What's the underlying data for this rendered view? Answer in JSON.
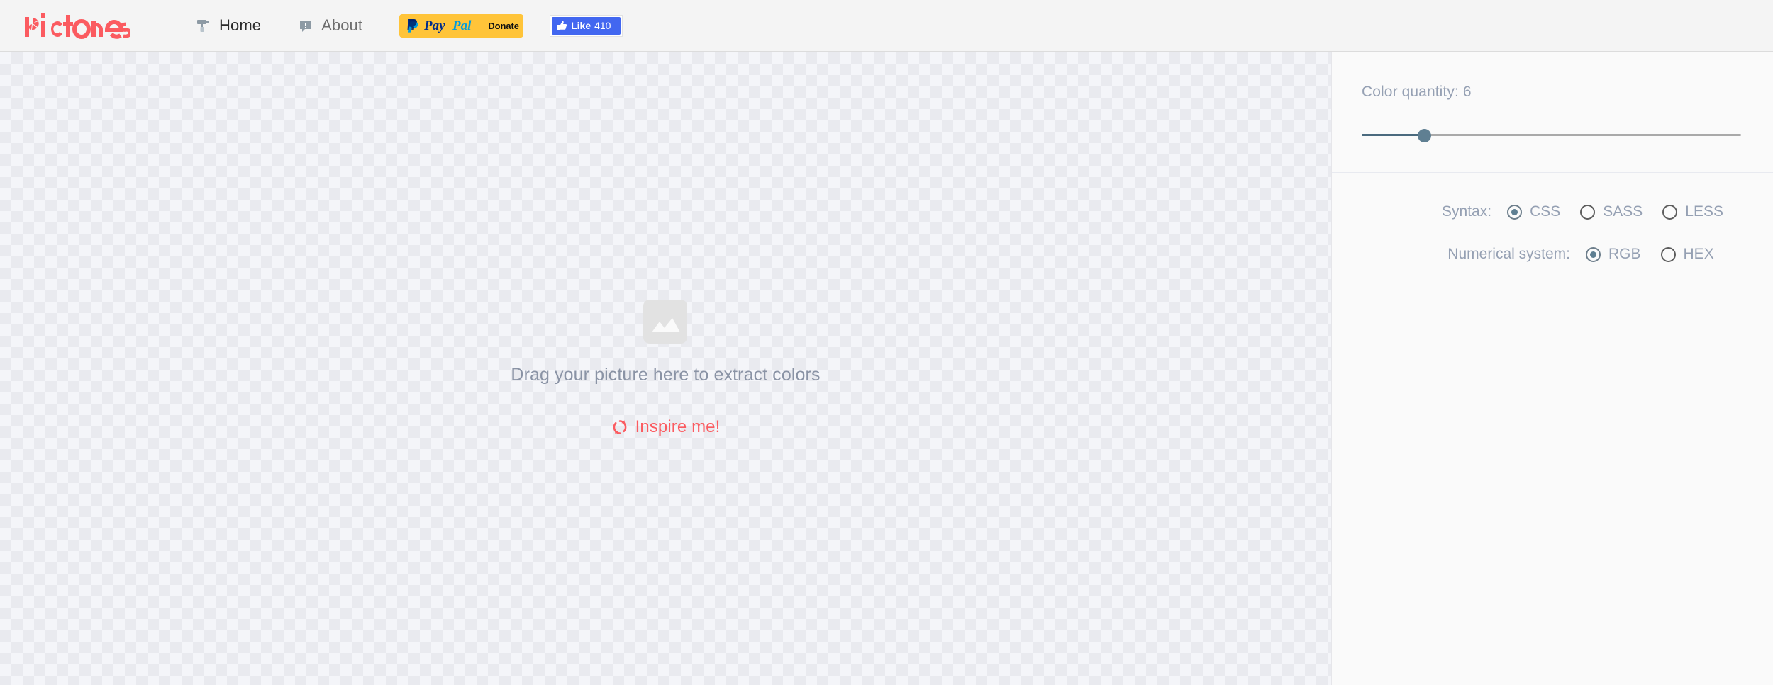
{
  "header": {
    "logo_text": "pictones",
    "logo_color": "#fb5b60",
    "nav": [
      {
        "label": "Home",
        "icon": "paint-roller-icon",
        "active": true
      },
      {
        "label": "About",
        "icon": "comment-alert-icon",
        "active": false
      }
    ],
    "paypal": {
      "brand": "PayPal",
      "action_label": "Donate",
      "bg_color": "#ffc439"
    },
    "facebook": {
      "like_label": "Like",
      "count": "410",
      "bg_color": "#4267f0"
    }
  },
  "dropzone": {
    "placeholder_icon": "image-placeholder-icon",
    "prompt": "Drag your picture here to extract colors",
    "inspire_label": "Inspire me!",
    "inspire_icon": "sync-refresh-icon",
    "inspire_color": "#fb5b60"
  },
  "sidebar": {
    "quantity": {
      "label": "Color quantity: 6",
      "value": 6,
      "slider_percent": 16
    },
    "syntax": {
      "label": "Syntax:",
      "options": [
        {
          "label": "CSS",
          "selected": true
        },
        {
          "label": "SASS",
          "selected": false
        },
        {
          "label": "LESS",
          "selected": false
        }
      ]
    },
    "numerical_system": {
      "label": "Numerical system:",
      "options": [
        {
          "label": "RGB",
          "selected": true
        },
        {
          "label": "HEX",
          "selected": false
        }
      ]
    }
  }
}
